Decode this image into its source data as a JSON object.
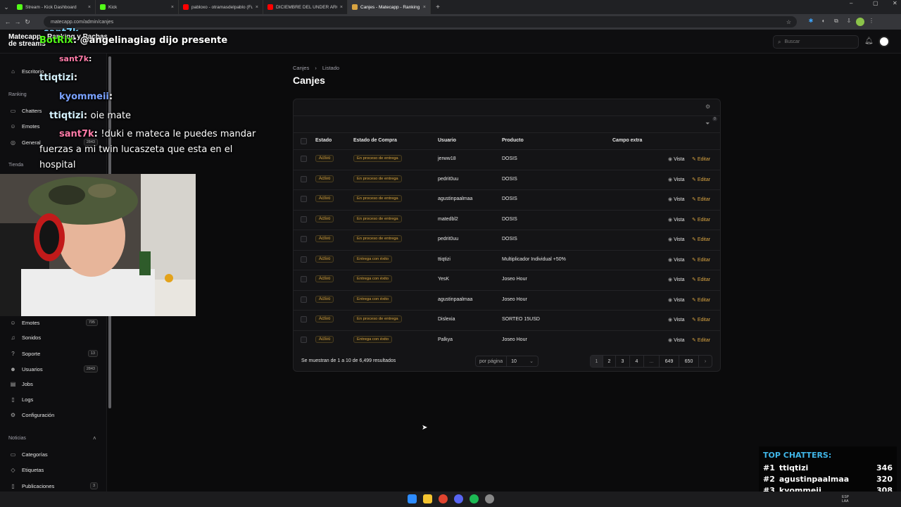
{
  "browser": {
    "tabs": [
      {
        "title": "Stream - Kick Dashboard",
        "color": "#53fc18"
      },
      {
        "title": "Kick",
        "color": "#53fc18"
      },
      {
        "title": "pabloxo - otramasdelpablo (Fu",
        "color": "#ff0000"
      },
      {
        "title": "DICIEMBRE DEL UNDER ARGEN",
        "color": "#ff0000"
      },
      {
        "title": "Canjes - Matecapp - Ranking y",
        "color": "#d9a441"
      }
    ],
    "new_tab": "+",
    "url": "matecapp.com/admin/canjes"
  },
  "app": {
    "brand_line1": "Matecapp - Ranking y Rachas",
    "brand_line2": "de streams",
    "search_placeholder": "Buscar"
  },
  "sidebar": {
    "items_top": [
      {
        "label": "Escritorio",
        "icon": "home-icon"
      }
    ],
    "section_ranking": "Ranking",
    "ranking_items": [
      {
        "label": "Chatters",
        "icon": "chat-icon"
      },
      {
        "label": "Emotes",
        "icon": "smile-icon"
      },
      {
        "label": "General",
        "icon": "globe-icon",
        "badge": "2843"
      }
    ],
    "section_tienda": "Tienda",
    "tienda_items": [
      {
        "label": "Emotes",
        "icon": "smile-icon",
        "badge": "795"
      },
      {
        "label": "Sonidos",
        "icon": "music-icon"
      },
      {
        "label": "Soporte",
        "icon": "help-icon",
        "badge": "13"
      },
      {
        "label": "Usuarios",
        "icon": "users-icon",
        "badge": "2843"
      },
      {
        "label": "Jobs",
        "icon": "briefcase-icon"
      },
      {
        "label": "Logs",
        "icon": "document-icon"
      },
      {
        "label": "Configuración",
        "icon": "gear-icon"
      }
    ],
    "section_noticias": "Noticias",
    "noticias_items": [
      {
        "label": "Categorías",
        "icon": "folder-icon"
      },
      {
        "label": "Etiquetas",
        "icon": "tag-icon"
      },
      {
        "label": "Publicaciones",
        "icon": "document-icon",
        "badge": "3"
      }
    ]
  },
  "page": {
    "breadcrumb": [
      "Canjes",
      "Listado"
    ],
    "title": "Canjes",
    "filter_count": "0",
    "columns": [
      "Estado",
      "Estado de Compra",
      "Usuario",
      "Producto",
      "Campo extra"
    ],
    "rows": [
      {
        "estado": "Activo",
        "compra": "En proceso de entrega",
        "usuario": "jerww18",
        "producto": "DOSIS"
      },
      {
        "estado": "Activo",
        "compra": "En proceso de entrega",
        "usuario": "pedrit0uu",
        "producto": "DOSIS"
      },
      {
        "estado": "Activo",
        "compra": "En proceso de entrega",
        "usuario": "agustinpaalmaa",
        "producto": "DOSIS"
      },
      {
        "estado": "Activo",
        "compra": "En proceso de entrega",
        "usuario": "matedbl2",
        "producto": "DOSIS"
      },
      {
        "estado": "Activo",
        "compra": "En proceso de entrega",
        "usuario": "pedrit0uu",
        "producto": "DOSIS"
      },
      {
        "estado": "Activo",
        "compra": "Entrega con éxito",
        "usuario": "ttiqtizi",
        "producto": "Multiplicador Individual +50%"
      },
      {
        "estado": "Activo",
        "compra": "Entrega con éxito",
        "usuario": "YesK",
        "producto": "Joseo Hour"
      },
      {
        "estado": "Activo",
        "compra": "Entrega con éxito",
        "usuario": "agustinpaalmaa",
        "producto": "Joseo Hour"
      },
      {
        "estado": "Activo",
        "compra": "En proceso de entrega",
        "usuario": "Dislexia",
        "producto": "SORTEO 15USD"
      },
      {
        "estado": "Activo",
        "compra": "Entrega con éxito",
        "usuario": "Palkya",
        "producto": "Joseo Hour"
      }
    ],
    "action_view": "Vista",
    "action_edit": "Editar",
    "results_text": "Se muestran de 1 a 10 de 6,499 resultados",
    "per_page_label": "por página",
    "per_page_value": "10",
    "pages": [
      "1",
      "2",
      "3",
      "4",
      "...",
      "649",
      "650"
    ],
    "next": "›"
  },
  "chat_overlay": [
    {
      "user": "sant7k",
      "text": ""
    },
    {
      "user": "BotRix",
      "text": "@angelinagiag dijo presente"
    },
    {
      "user": "sant7k",
      "text": ""
    },
    {
      "user": "ttiqtizi",
      "text": ""
    },
    {
      "user": "kyommeii",
      "text": ""
    },
    {
      "user": "ttiqtizi",
      "text": "oie mate"
    },
    {
      "user": "sant7k",
      "text": "!duki e mateca le puedes mandar fuerzas a mi twin lucaszeta que esta en el hospital"
    }
  ],
  "top_chatters": {
    "title": "TOP CHATTERS:",
    "rows": [
      {
        "rank": "#1",
        "name": "ttiqtizi",
        "count": "346"
      },
      {
        "rank": "#2",
        "name": "agustinpaalmaa",
        "count": "320"
      },
      {
        "rank": "#3",
        "name": "kyommeii",
        "count": "308"
      }
    ]
  },
  "taskbar": {
    "lang": "ESP LAA"
  }
}
